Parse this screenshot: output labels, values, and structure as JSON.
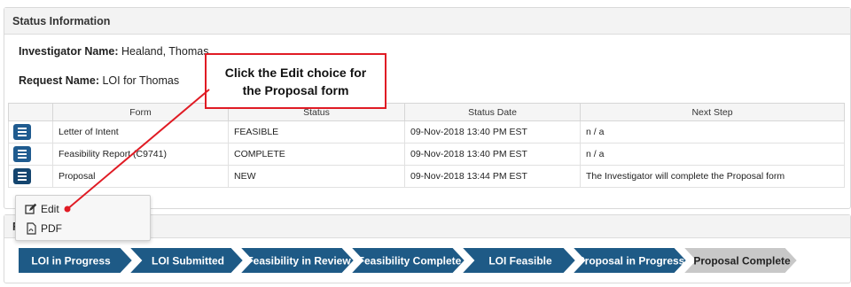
{
  "status_panel": {
    "title": "Status Information",
    "investigator_label": "Investigator Name:",
    "investigator_value": "Healand, Thomas",
    "request_label": "Request Name:",
    "request_value": "LOI for Thomas"
  },
  "table": {
    "headers": [
      "",
      "Form",
      "Status",
      "Status Date",
      "Next Step"
    ],
    "rows": [
      {
        "form": "Letter of Intent",
        "status": "FEASIBLE",
        "date": "09-Nov-2018 13:40 PM EST",
        "next": "n / a"
      },
      {
        "form": "Feasibility Report (C9741)",
        "status": "COMPLETE",
        "date": "09-Nov-2018 13:40 PM EST",
        "next": "n / a"
      },
      {
        "form": "Proposal",
        "status": "NEW",
        "date": "09-Nov-2018 13:44 PM EST",
        "next": "The Investigator will complete the Proposal form"
      }
    ]
  },
  "dropdown": {
    "edit_label": "Edit",
    "pdf_label": "PDF"
  },
  "panel2": {
    "title_visible": "R"
  },
  "callout": {
    "line1": "Click the Edit choice for",
    "line2": "the Proposal form"
  },
  "progress_steps": [
    {
      "label": "LOI in Progress",
      "state": "done"
    },
    {
      "label": "LOI Submitted",
      "state": "done"
    },
    {
      "label": "Feasibility in Review",
      "state": "done"
    },
    {
      "label": "Feasibility Complete",
      "state": "done"
    },
    {
      "label": "LOI Feasible",
      "state": "done"
    },
    {
      "label": "Proposal in Progress",
      "state": "done"
    },
    {
      "label": "Proposal Complete",
      "state": "pending"
    }
  ],
  "colors": {
    "step_done": "#1e5a86",
    "step_pending": "#c8c8c8",
    "callout_border": "#e01b24",
    "menu_button": "#1f5b8f"
  }
}
